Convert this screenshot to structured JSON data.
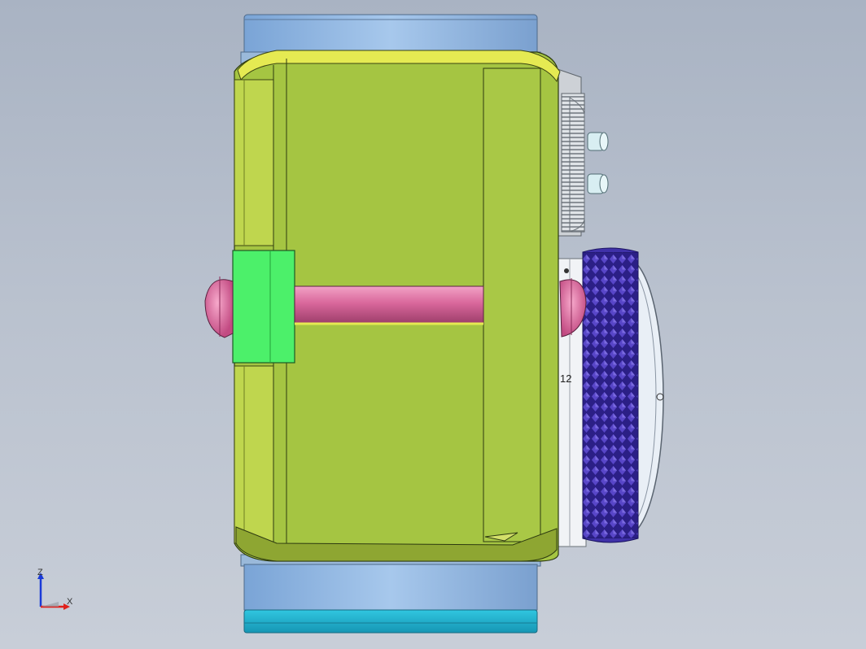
{
  "colors": {
    "background_top": "#a9b3c3",
    "background_bottom": "#c8ced8",
    "barrel_blue": "#8fb6e3",
    "barrel_cyan": "#1fb3cf",
    "body_yellow_green": "#a5c542",
    "bright_yellow": "#e5ea52",
    "bright_green": "#4cf06a",
    "pink_rod": "#d76a9a",
    "knurl_purple": "#3a2a9e",
    "dial_face": "#e8eef5",
    "metal_grey": "#c9ced4"
  },
  "dial": {
    "number": "12"
  },
  "triad": {
    "z_label": "Z",
    "x_label": "X"
  }
}
